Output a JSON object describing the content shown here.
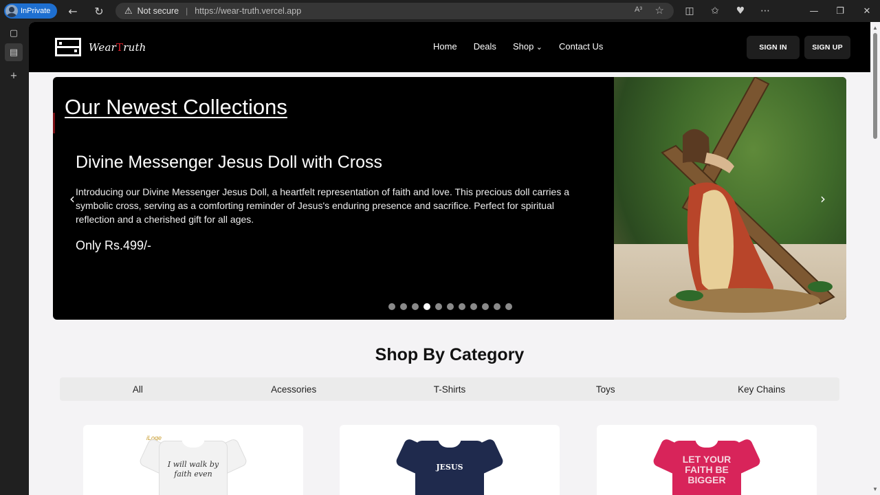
{
  "browser": {
    "inprivate_label": "InPrivate",
    "security_text": "Not secure",
    "url": "https://wear-truth.vercel.app",
    "read_aloud_icon": "A³"
  },
  "header": {
    "logo_text_pre": "Wear",
    "logo_text_cross": "T",
    "logo_text_post": "ruth",
    "nav": [
      "Home",
      "Deals",
      "Shop",
      "Contact Us"
    ],
    "sign_in": "SIGN IN",
    "sign_up": "SIGN UP"
  },
  "carousel": {
    "heading": "Our Newest Collections",
    "title": "Divine Messenger Jesus Doll with Cross",
    "description": "Introducing our Divine Messenger Jesus Doll, a heartfelt representation of faith and love. This precious doll carries a symbolic cross, serving as a comforting reminder of Jesus's enduring presence and sacrifice. Perfect for spiritual reflection and a cherished gift for all ages.",
    "price": "Only Rs.499/-",
    "slide_count": 11,
    "active_slide": 4
  },
  "category": {
    "title": "Shop By Category",
    "tabs": [
      "All",
      "Acessories",
      "T-Shirts",
      "Toys",
      "Key Chains"
    ]
  },
  "products": [
    {
      "color": "#f2f2f2",
      "print": "I will walk by faith even",
      "print_color": "#333333",
      "brand": "iLoge"
    },
    {
      "color": "#1f2a4d",
      "print": "JESUS",
      "print_color": "#ffffff"
    },
    {
      "color": "#d8245a",
      "print": "LET YOUR FAITH BE BIGGER",
      "print_color": "#f6d6df"
    }
  ]
}
